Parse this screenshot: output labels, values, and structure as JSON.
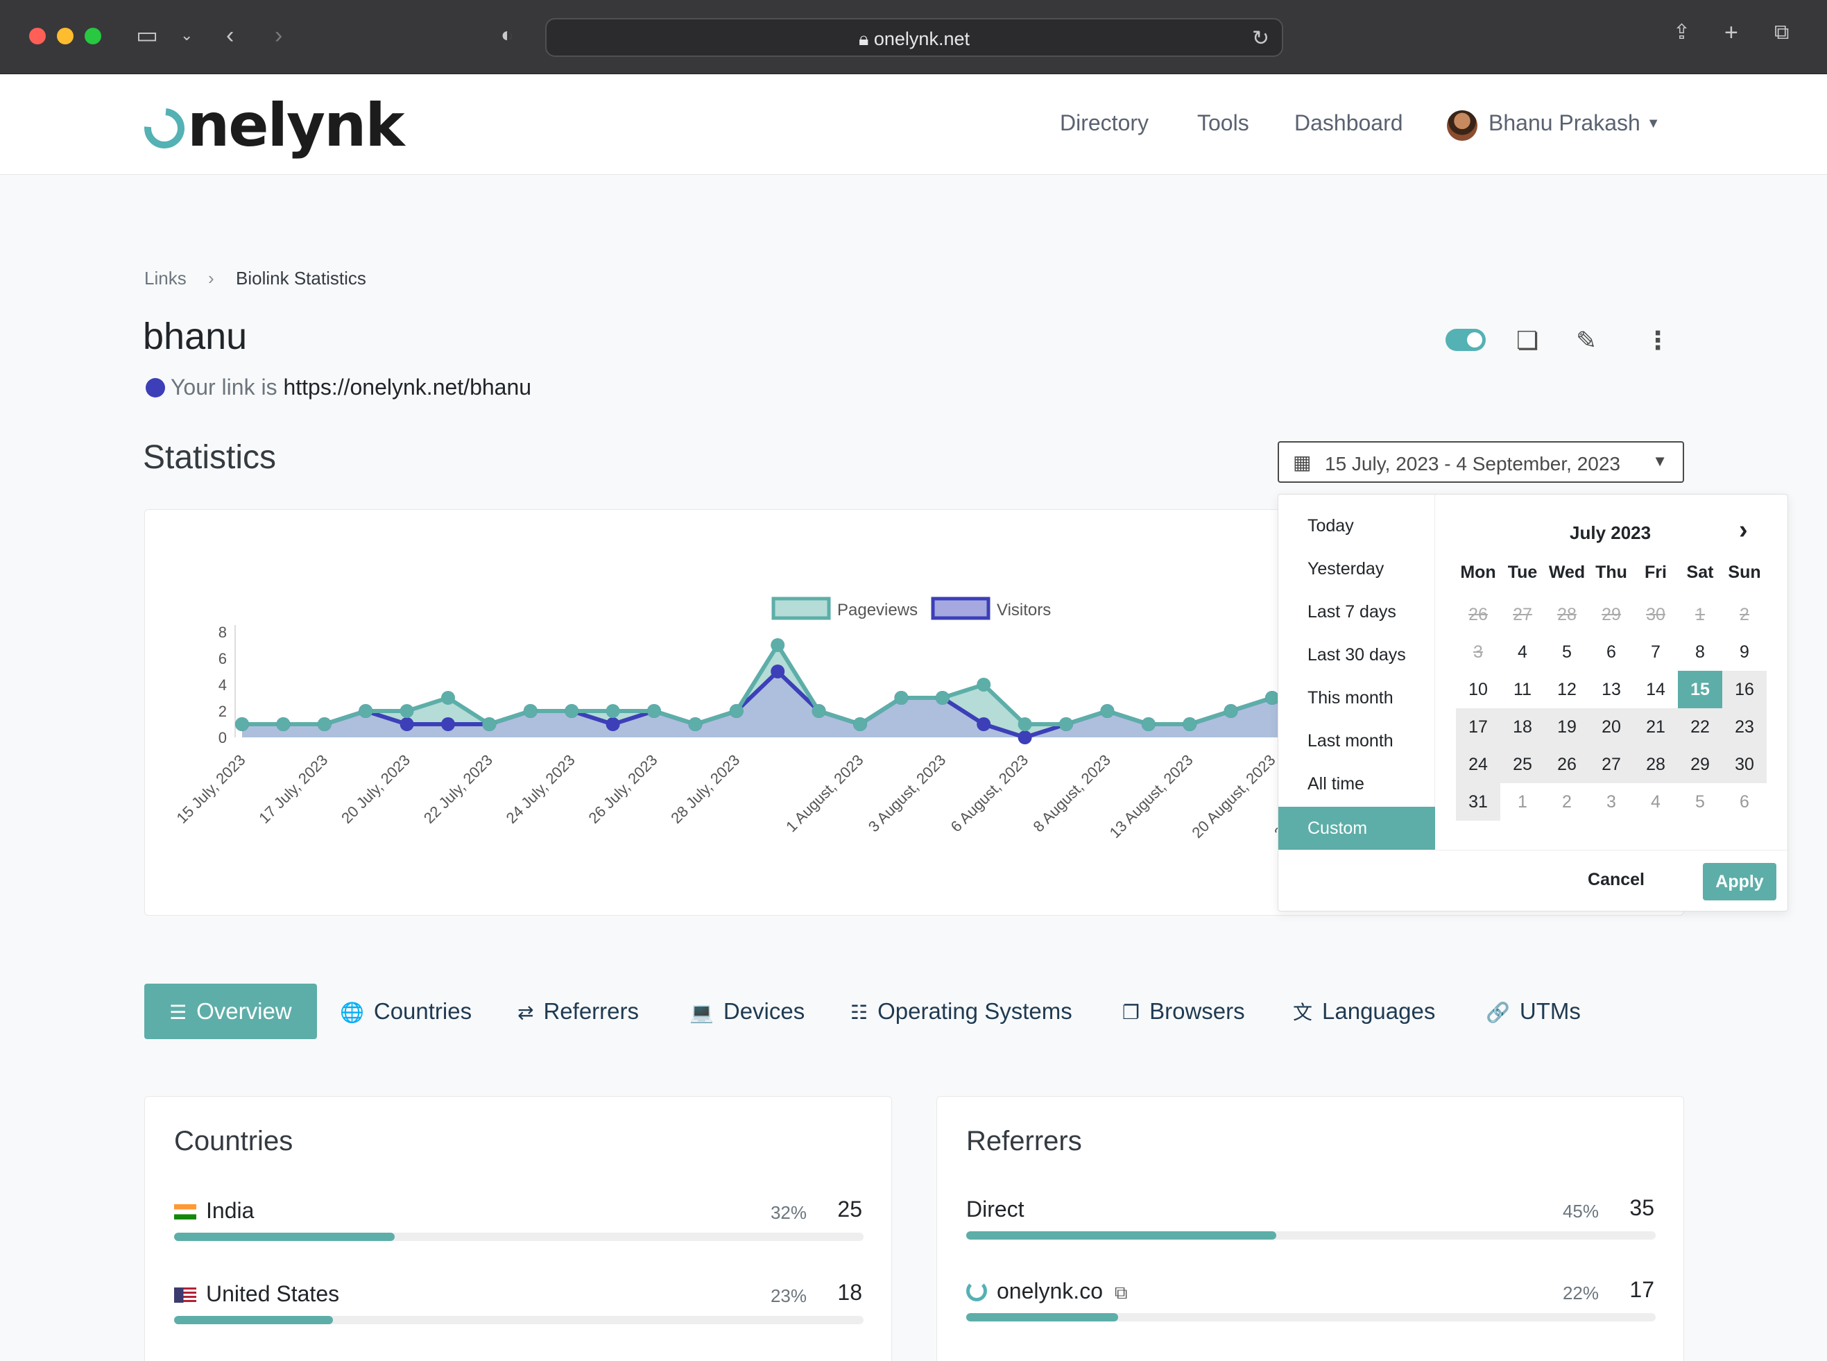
{
  "browser": {
    "url": "onelynk.net",
    "traffic_colors": [
      "#ff5f57",
      "#febc2e",
      "#28c840"
    ]
  },
  "header": {
    "logo_text": "nelynk",
    "nav": [
      "Directory",
      "Tools",
      "Dashboard"
    ],
    "user_name": "Bhanu Prakash"
  },
  "breadcrumb": {
    "parent": "Links",
    "separator": "›",
    "current": "Biolink Statistics"
  },
  "link": {
    "name": "bhanu",
    "prefix": "Your link is",
    "url": "https://onelynk.net/bhanu",
    "enabled": true
  },
  "statistics": {
    "title": "Statistics",
    "date_range": "15 July, 2023 - 4 September, 2023"
  },
  "chart_data": {
    "type": "area",
    "title": "",
    "x": [
      "15 July, 2023",
      "16 July, 2023",
      "17 July, 2023",
      "19 July, 2023",
      "20 July, 2023",
      "21 July, 2023",
      "22 July, 2023",
      "23 July, 2023",
      "24 July, 2023",
      "25 July, 2023",
      "26 July, 2023",
      "27 July, 2023",
      "28 July, 2023",
      "29 July, 2023",
      "31 July, 2023",
      "1 August, 2023",
      "2 August, 2023",
      "3 August, 2023",
      "5 August, 2023",
      "6 August, 2023",
      "7 August, 2023",
      "8 August, 2023",
      "12 August, 2023",
      "13 August, 2023",
      "19 August, 2023",
      "20 August, 2023",
      "21 August, 2023",
      "22 August, 2023"
    ],
    "tick_labels": [
      "15 July, 2023",
      "17 July, 2023",
      "20 July, 2023",
      "22 July, 2023",
      "24 July, 2023",
      "26 July, 2023",
      "28 July, 2023",
      "1 August, 2023",
      "3 August, 2023",
      "6 August, 2023",
      "8 August, 2023",
      "13 August, 2023",
      "20 August, 2023",
      "22 August, 2023"
    ],
    "series": [
      {
        "name": "Pageviews",
        "color": "#5daea8",
        "fill": "#b5dcd7",
        "values": [
          1,
          1,
          1,
          2,
          2,
          3,
          1,
          2,
          2,
          2,
          2,
          1,
          2,
          7,
          2,
          1,
          3,
          3,
          4,
          1,
          1,
          2,
          1,
          1,
          2,
          3,
          1,
          1
        ]
      },
      {
        "name": "Visitors",
        "color": "#3c3fb8",
        "fill": "#a6a8e0",
        "values": [
          1,
          1,
          1,
          2,
          1,
          1,
          1,
          2,
          2,
          1,
          2,
          1,
          2,
          5,
          2,
          1,
          3,
          3,
          1,
          0,
          1,
          2,
          1,
          1,
          2,
          3,
          1,
          1
        ]
      }
    ],
    "yticks": [
      0,
      2,
      4,
      6,
      8
    ],
    "ylim": [
      0,
      8
    ],
    "legend": "top-center",
    "grid": false
  },
  "datepicker": {
    "ranges": [
      "Today",
      "Yesterday",
      "Last 7 days",
      "Last 30 days",
      "This month",
      "Last month",
      "All time",
      "Custom"
    ],
    "active_range": "Custom",
    "month_title": "July 2023",
    "weekdays": [
      "Mon",
      "Tue",
      "Wed",
      "Thu",
      "Fri",
      "Sat",
      "Sun"
    ],
    "days": [
      {
        "n": "26",
        "s": "struck"
      },
      {
        "n": "27",
        "s": "struck"
      },
      {
        "n": "28",
        "s": "struck"
      },
      {
        "n": "29",
        "s": "struck"
      },
      {
        "n": "30",
        "s": "struck"
      },
      {
        "n": "1",
        "s": "struck"
      },
      {
        "n": "2",
        "s": "struck"
      },
      {
        "n": "3",
        "s": "struck"
      },
      {
        "n": "4",
        "s": ""
      },
      {
        "n": "5",
        "s": ""
      },
      {
        "n": "6",
        "s": ""
      },
      {
        "n": "7",
        "s": ""
      },
      {
        "n": "8",
        "s": ""
      },
      {
        "n": "9",
        "s": ""
      },
      {
        "n": "10",
        "s": ""
      },
      {
        "n": "11",
        "s": ""
      },
      {
        "n": "12",
        "s": ""
      },
      {
        "n": "13",
        "s": ""
      },
      {
        "n": "14",
        "s": ""
      },
      {
        "n": "15",
        "s": "start"
      },
      {
        "n": "16",
        "s": "inrange"
      },
      {
        "n": "17",
        "s": "inrange"
      },
      {
        "n": "18",
        "s": "inrange"
      },
      {
        "n": "19",
        "s": "inrange"
      },
      {
        "n": "20",
        "s": "inrange"
      },
      {
        "n": "21",
        "s": "inrange"
      },
      {
        "n": "22",
        "s": "inrange"
      },
      {
        "n": "23",
        "s": "inrange"
      },
      {
        "n": "24",
        "s": "inrange"
      },
      {
        "n": "25",
        "s": "inrange"
      },
      {
        "n": "26",
        "s": "inrange"
      },
      {
        "n": "27",
        "s": "inrange"
      },
      {
        "n": "28",
        "s": "inrange"
      },
      {
        "n": "29",
        "s": "inrange"
      },
      {
        "n": "30",
        "s": "inrange"
      },
      {
        "n": "31",
        "s": "inrange"
      },
      {
        "n": "1",
        "s": "off"
      },
      {
        "n": "2",
        "s": "off"
      },
      {
        "n": "3",
        "s": "off"
      },
      {
        "n": "4",
        "s": "off"
      },
      {
        "n": "5",
        "s": "off"
      },
      {
        "n": "6",
        "s": "off"
      }
    ],
    "cancel_label": "Cancel",
    "apply_label": "Apply"
  },
  "tabs": [
    {
      "label": "Overview",
      "icon": "list-icon",
      "glyph": "☰",
      "active": true
    },
    {
      "label": "Countries",
      "icon": "globe-icon",
      "glyph": "🌐",
      "active": false
    },
    {
      "label": "Referrers",
      "icon": "shuffle-icon",
      "glyph": "⇄",
      "active": false
    },
    {
      "label": "Devices",
      "icon": "laptop-icon",
      "glyph": "💻",
      "active": false
    },
    {
      "label": "Operating Systems",
      "icon": "server-icon",
      "glyph": "☷",
      "active": false
    },
    {
      "label": "Browsers",
      "icon": "browser-icon",
      "glyph": "❐",
      "active": false
    },
    {
      "label": "Languages",
      "icon": "language-icon",
      "glyph": "文",
      "active": false
    },
    {
      "label": "UTMs",
      "icon": "link-icon",
      "glyph": "🔗",
      "active": false
    }
  ],
  "countries": {
    "title": "Countries",
    "rows": [
      {
        "label": "India",
        "percent": "32%",
        "value": "25",
        "fraction": 0.32
      },
      {
        "label": "United States",
        "percent": "23%",
        "value": "18",
        "fraction": 0.23
      }
    ]
  },
  "referrers": {
    "title": "Referrers",
    "rows": [
      {
        "label": "Direct",
        "percent": "45%",
        "value": "35",
        "fraction": 0.45
      },
      {
        "label": "onelynk.co",
        "percent": "22%",
        "value": "17",
        "fraction": 0.22
      }
    ]
  },
  "colors": {
    "accent": "#5daea8",
    "visitors": "#3c3fb8"
  }
}
